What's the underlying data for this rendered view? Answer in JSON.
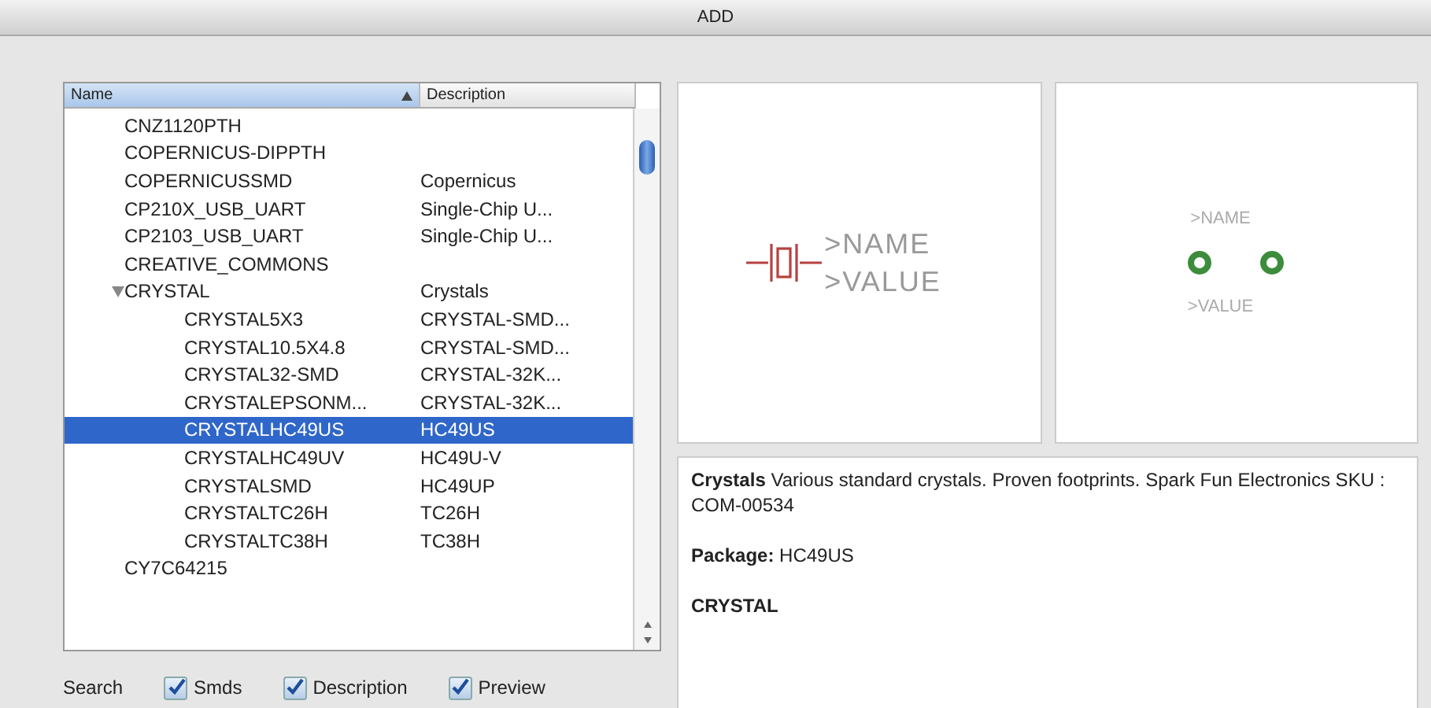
{
  "window": {
    "title": "ADD"
  },
  "list": {
    "columns": [
      {
        "label": "Name",
        "sorted": true
      },
      {
        "label": "Description",
        "sorted": false
      }
    ],
    "items": [
      {
        "name": "CNZ1120PTH",
        "selected": false
      },
      {
        "name": "COPERNICUS-DIPPTH",
        "selected": false
      },
      {
        "name": "COPERNICUSSMD",
        "description": "Copernicus",
        "selected": false
      },
      {
        "name": "CP210X_USB_UART",
        "description": "Single-Chip U...",
        "selected": false
      },
      {
        "name": "CP2103_USB_UART",
        "description": "Single-Chip U...",
        "selected": false
      },
      {
        "name": "CREATIVE_COMMONS",
        "selected": false
      },
      {
        "name": "CRYSTAL",
        "description": "Crystals",
        "selected": false,
        "expanded": true,
        "children": [
          {
            "name": "CRYSTAL5X3",
            "description": "CRYSTAL-SMD...",
            "selected": false
          },
          {
            "name": "CRYSTAL10.5X4.8",
            "description": "CRYSTAL-SMD...",
            "selected": false
          },
          {
            "name": "CRYSTAL32-SMD",
            "description": "CRYSTAL-32K...",
            "selected": false
          },
          {
            "name": "CRYSTALEPSONM...",
            "description": "CRYSTAL-32K...",
            "selected": false
          },
          {
            "name": "CRYSTALHC49US",
            "description": "HC49US",
            "selected": true
          },
          {
            "name": "CRYSTALHC49UV",
            "description": "HC49U-V",
            "selected": false
          },
          {
            "name": "CRYSTALSMD",
            "description": "HC49UP",
            "selected": false
          },
          {
            "name": "CRYSTALTC26H",
            "description": "TC26H",
            "selected": false
          },
          {
            "name": "CRYSTALTC38H",
            "description": "TC38H",
            "selected": false
          }
        ]
      },
      {
        "name": "CY7C64215",
        "selected": false
      }
    ]
  },
  "search": {
    "label": "Search",
    "options": [
      {
        "label": "Smds",
        "checked": true
      },
      {
        "label": "Description",
        "checked": true
      },
      {
        "label": "Preview",
        "checked": true
      }
    ]
  },
  "symbol_preview": {
    "name_label": ">NAME",
    "value_label": ">VALUE"
  },
  "package_preview": {
    "name_label": ">NAME",
    "value_label": ">VALUE"
  },
  "details": {
    "description": "**Crystals** Various standard crystals. Proven footprints. Spark Fun Electronics SKU : COM-00534",
    "package": "**Package:** HC49US",
    "device": "CRYSTAL"
  }
}
